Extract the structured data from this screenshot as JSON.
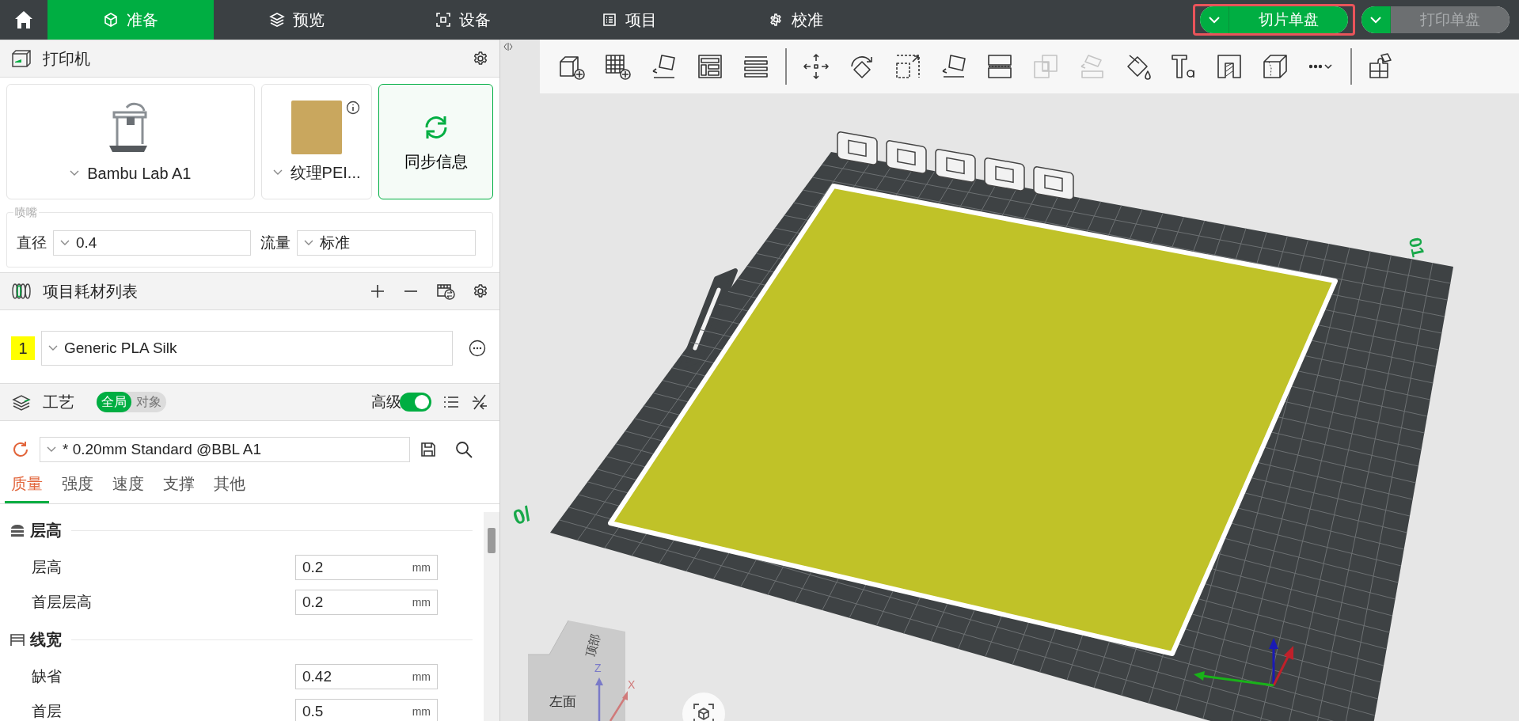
{
  "top_bar": {
    "tabs": [
      {
        "label": "准备",
        "kind": "prepare",
        "selected": true
      },
      {
        "label": "预览",
        "kind": "preview",
        "selected": false
      },
      {
        "label": "设备",
        "kind": "device",
        "selected": false
      },
      {
        "label": "项目",
        "kind": "project",
        "selected": false
      },
      {
        "label": "校准",
        "kind": "calibrate",
        "selected": false
      }
    ],
    "slice_button": {
      "label": "切片单盘",
      "disabled": false,
      "highlighted": true
    },
    "print_button": {
      "label": "打印单盘",
      "disabled": true
    }
  },
  "printer": {
    "title": "打印机",
    "printer_name": "Bambu Lab A1",
    "plate_name": "纹理PEI...",
    "sync_button": "同步信息",
    "nozzle": {
      "legend": "喷嘴",
      "diameter_label": "直径",
      "diameter": "0.4",
      "flow_label": "流量",
      "flow": "标准"
    }
  },
  "filaments": {
    "title": "项目耗材列表",
    "items": [
      {
        "index": "1",
        "name": "Generic PLA Silk",
        "color": "#ffff00"
      }
    ]
  },
  "process": {
    "title": "工艺",
    "scope": [
      {
        "label": "全局",
        "selected": true
      },
      {
        "label": "对象",
        "selected": false
      }
    ],
    "advanced_label": "高级",
    "advanced": true,
    "preset": "* 0.20mm Standard @BBL A1",
    "tabs": [
      {
        "label": "质量",
        "selected": true
      },
      {
        "label": "强度",
        "selected": false
      },
      {
        "label": "速度",
        "selected": false
      },
      {
        "label": "支撑",
        "selected": false
      },
      {
        "label": "其他",
        "selected": false
      }
    ],
    "groups": [
      {
        "title": "层高",
        "kind": "layers",
        "settings": [
          {
            "label": "层高",
            "value": "0.2",
            "unit": "mm"
          },
          {
            "label": "首层层高",
            "value": "0.2",
            "unit": "mm"
          }
        ]
      },
      {
        "title": "线宽",
        "kind": "width",
        "settings": [
          {
            "label": "缺省",
            "value": "0.42",
            "unit": "mm"
          },
          {
            "label": "首层",
            "value": "0.5",
            "unit": "mm"
          }
        ]
      }
    ]
  },
  "toolbar": {
    "groups": [
      {
        "items": [
          {
            "kind": "add-part",
            "disabled": false
          },
          {
            "kind": "add-plate",
            "disabled": false
          },
          {
            "kind": "auto-orient",
            "disabled": false
          },
          {
            "kind": "arrange",
            "disabled": false
          },
          {
            "kind": "layers",
            "disabled": false
          }
        ]
      },
      {
        "items": [
          {
            "kind": "move",
            "disabled": false
          },
          {
            "kind": "rotate",
            "disabled": false
          },
          {
            "kind": "scale",
            "disabled": false
          },
          {
            "kind": "lay-on-face",
            "disabled": false
          },
          {
            "kind": "cut",
            "disabled": false
          },
          {
            "kind": "boolean",
            "disabled": true
          },
          {
            "kind": "support",
            "disabled": true
          },
          {
            "kind": "paint",
            "disabled": false
          },
          {
            "kind": "text",
            "disabled": false
          },
          {
            "kind": "emboss",
            "disabled": false
          },
          {
            "kind": "seam",
            "disabled": false
          },
          {
            "kind": "more",
            "disabled": false
          }
        ]
      },
      {
        "items": [
          {
            "kind": "assembly",
            "disabled": false
          }
        ]
      }
    ]
  },
  "viewport": {
    "plate_labels": [
      "01",
      "0/"
    ],
    "view_cube": {
      "top": "顶部",
      "left": "左面"
    },
    "axes": {
      "z": "Z",
      "x": "X"
    }
  }
}
